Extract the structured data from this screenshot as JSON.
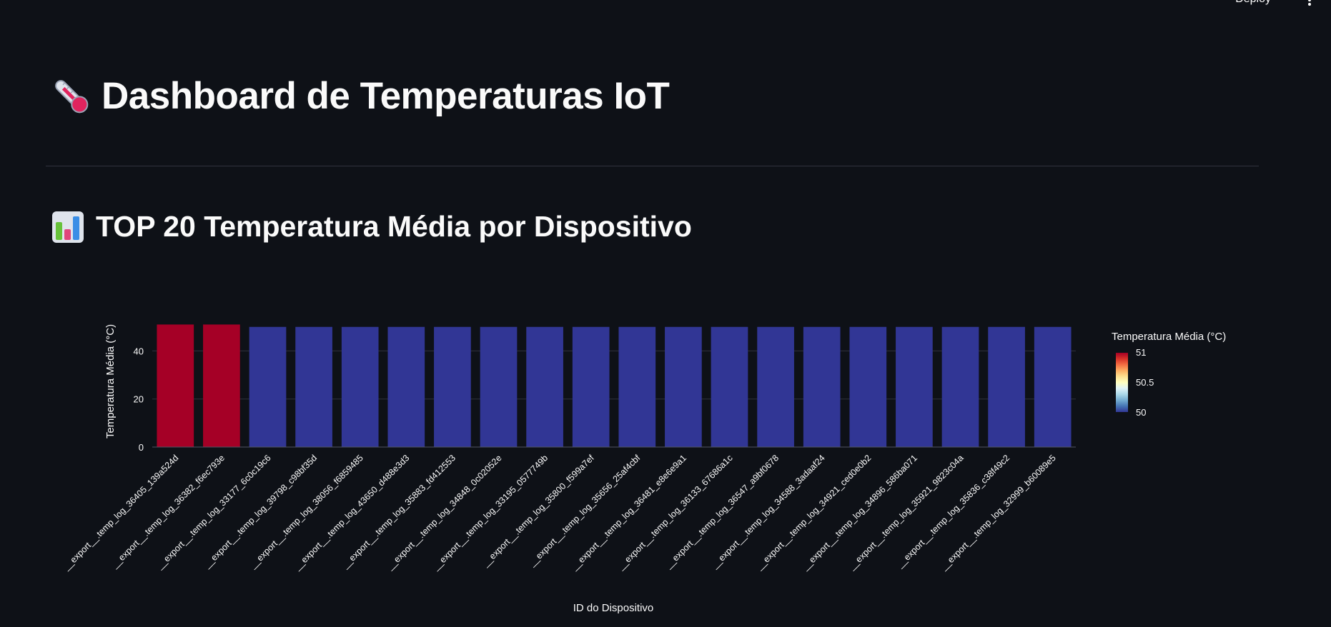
{
  "header": {
    "deploy_label": "Deploy"
  },
  "page": {
    "title": "Dashboard de Temperaturas IoT",
    "title_icon": "thermometer-icon",
    "section_title": "TOP 20 Temperatura Média por Dispositivo",
    "section_icon": "bar-chart-icon"
  },
  "chart_data": {
    "type": "bar",
    "xlabel": "ID do Dispositivo",
    "ylabel": "Temperatura Média (°C)",
    "ylim": [
      0,
      53.5
    ],
    "yticks": [
      0,
      20,
      40
    ],
    "grid": true,
    "colorbar": {
      "title": "Temperatura Média (°C)",
      "ticks": [
        "51",
        "50.5",
        "50"
      ],
      "range": [
        50,
        51
      ],
      "placement": "right"
    },
    "categories": [
      "__export__.temp_log_36405_139a524d",
      "__export__.temp_log_36382_f6ec793e",
      "__export__.temp_log_33177_6c0c19c6",
      "__export__.temp_log_39798_c98bf35d",
      "__export__.temp_log_38056_f6859485",
      "__export__.temp_log_43650_d488e3d3",
      "__export__.temp_log_35883_fd412553",
      "__export__.temp_log_34848_0c02052e",
      "__export__.temp_log_33195_0577749b",
      "__export__.temp_log_35800_f599a7ef",
      "__export__.temp_log_35656_25af4cbf",
      "__export__.temp_log_36481_e8e6e9a1",
      "__export__.temp_log_36133_67686a1c",
      "__export__.temp_log_36547_a9bf0678",
      "__export__.temp_log_34588_3adaaf24",
      "__export__.temp_log_34921_ced0e0b2",
      "__export__.temp_log_34896_586ba071",
      "__export__.temp_log_35921_9823c04a",
      "__export__.temp_log_35836_c38f49c2",
      "__export__.temp_log_32999_b60089e5"
    ],
    "values": [
      51,
      51,
      50,
      50,
      50,
      50,
      50,
      50,
      50,
      50,
      50,
      50,
      50,
      50,
      50,
      50,
      50,
      50,
      50,
      50
    ],
    "colors": {
      "high": "#a50026",
      "low": "#313695",
      "grid": "#31333f",
      "text": "#fafafa"
    }
  }
}
